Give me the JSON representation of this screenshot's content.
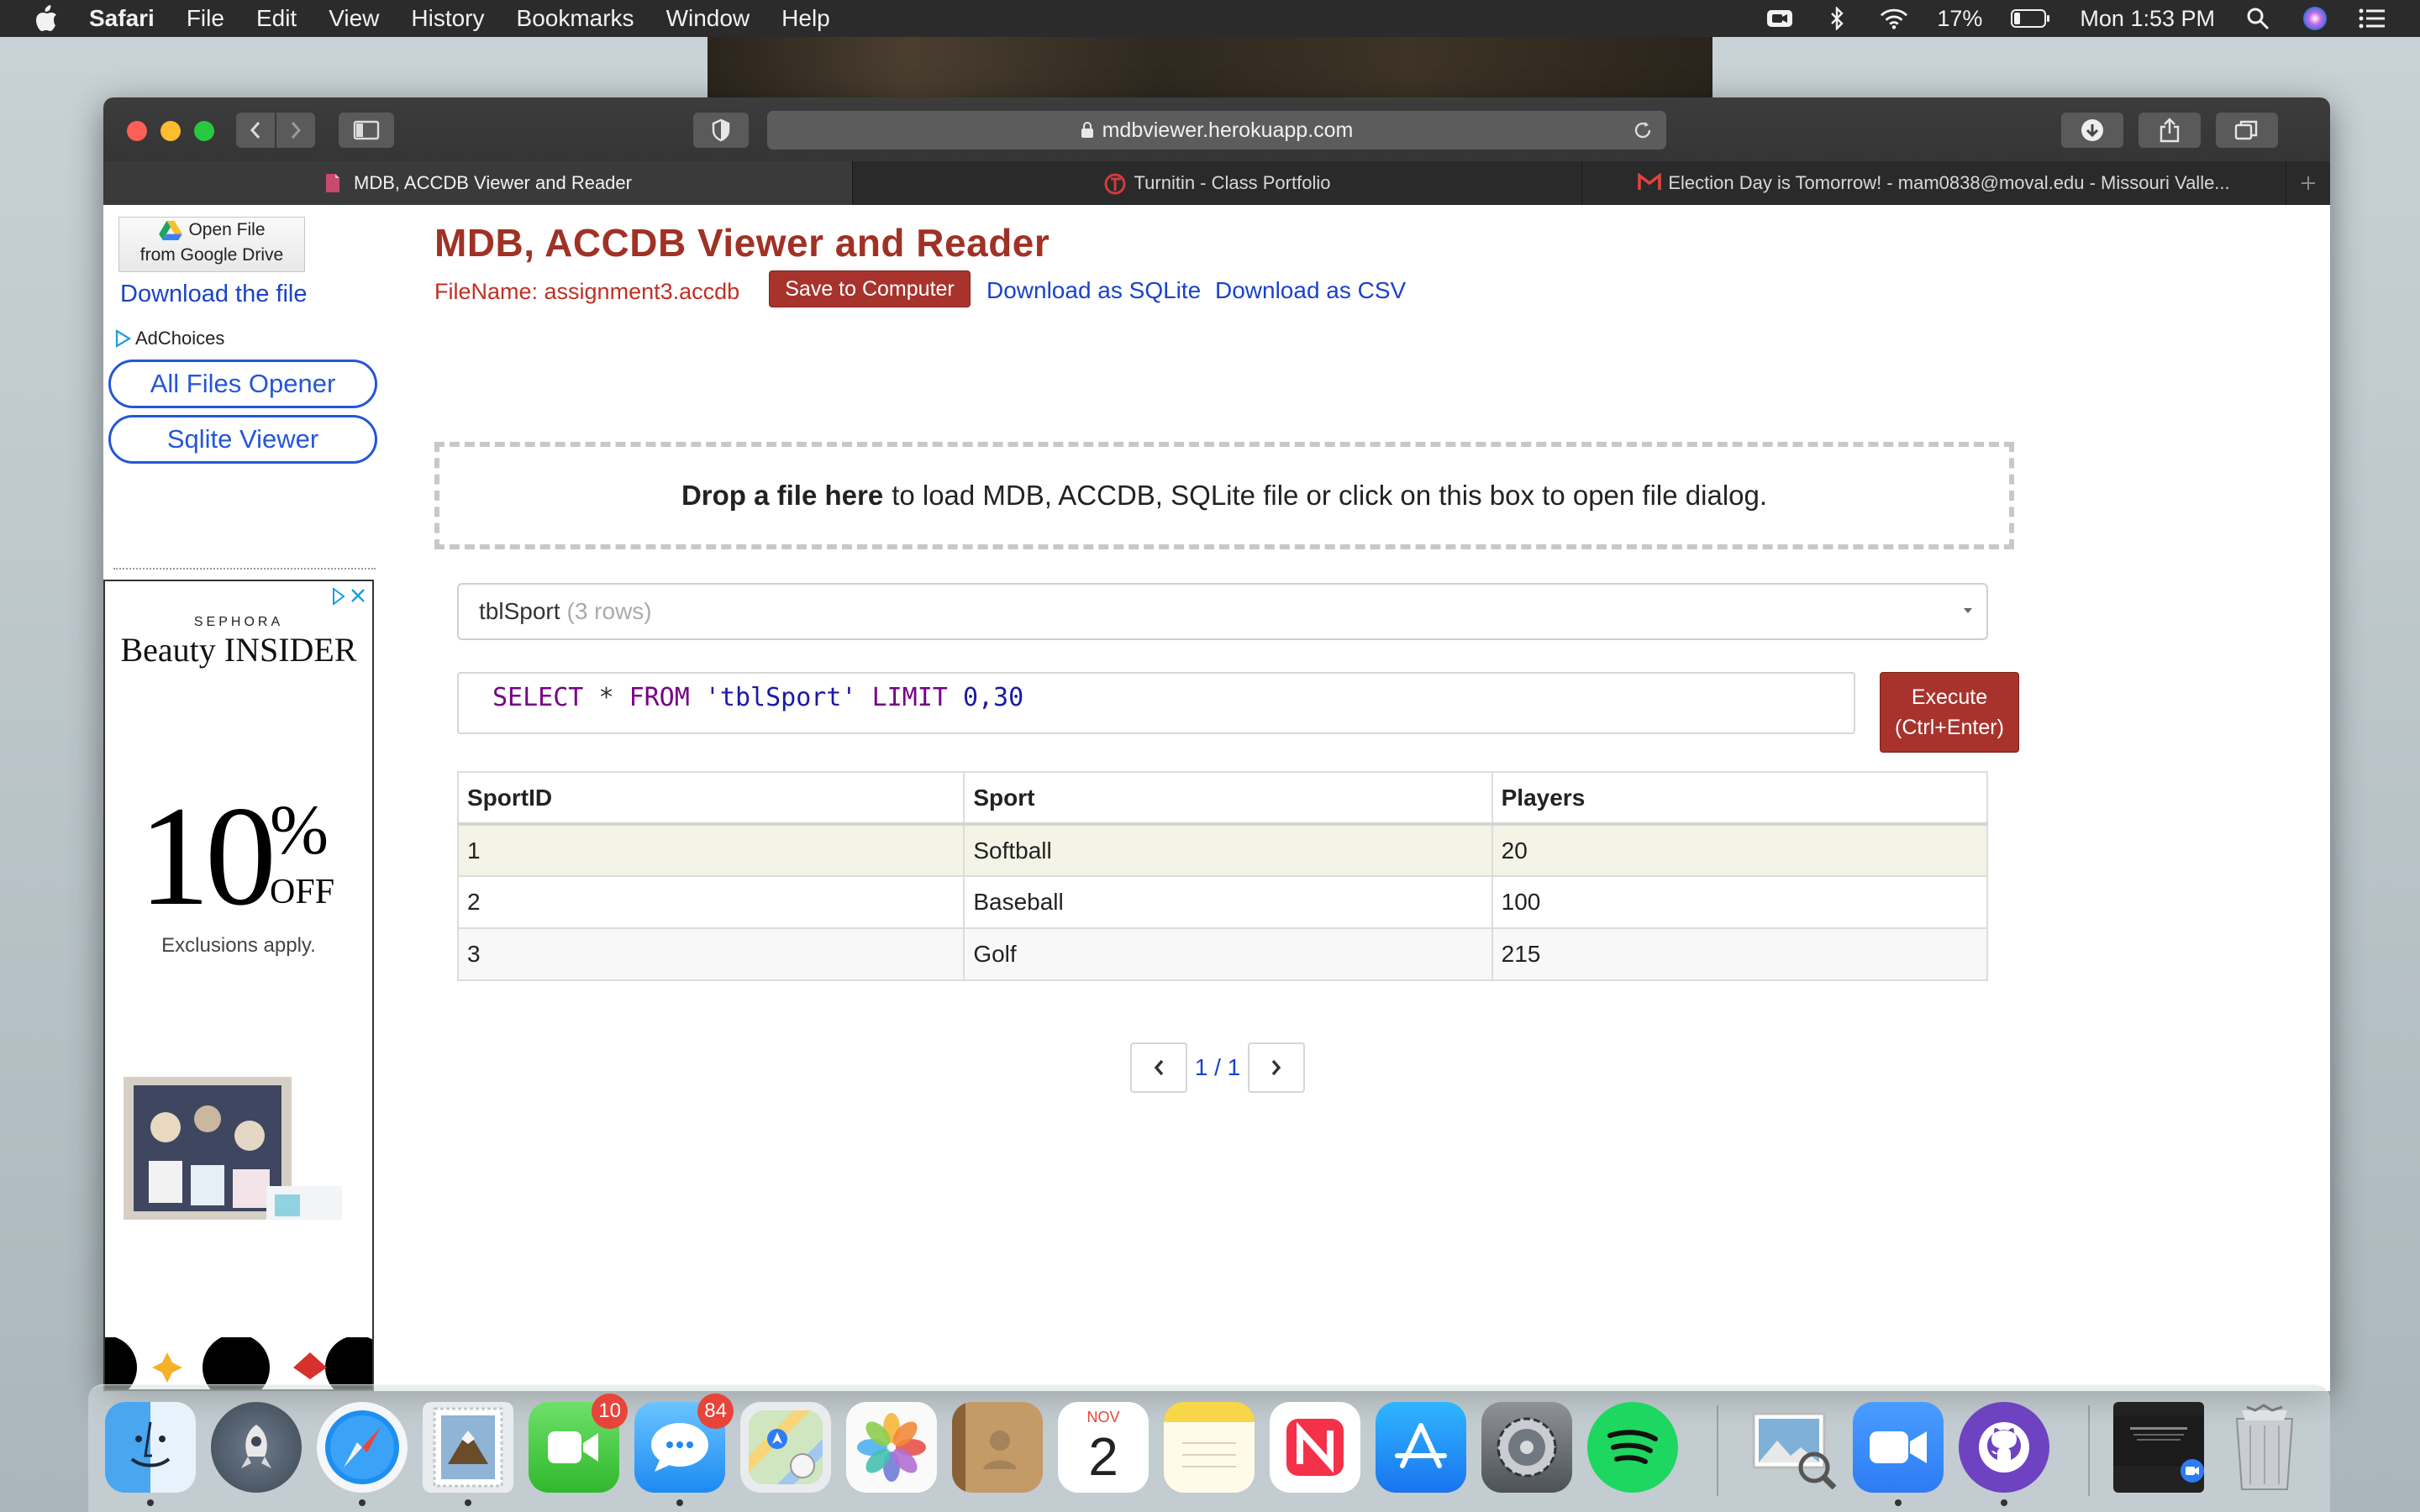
{
  "menubar": {
    "app": "Safari",
    "items": [
      "File",
      "Edit",
      "View",
      "History",
      "Bookmarks",
      "Window",
      "Help"
    ],
    "battery": "17%",
    "clock": "Mon 1:53 PM"
  },
  "browser": {
    "url": "mdbviewer.herokuapp.com",
    "tabs": [
      {
        "label": "MDB, ACCDB Viewer and Reader"
      },
      {
        "label": "Turnitin - Class Portfolio"
      },
      {
        "label": "Election Day is Tomorrow! - mam0838@moval.edu - Missouri Valle..."
      }
    ]
  },
  "sidebar": {
    "gdrive_line1": "Open File",
    "gdrive_line2": "from Google Drive",
    "download_link": "Download the file",
    "adchoices": "AdChoices",
    "all_files": "All Files Opener",
    "sqlite_viewer": "Sqlite Viewer",
    "ad": {
      "brand": "SEPHORA",
      "program": "Beauty INSIDER",
      "big": "10",
      "percent": "%",
      "off": "OFF",
      "note": "Exclusions apply."
    }
  },
  "main": {
    "title": "MDB, ACCDB Viewer and Reader",
    "filename": "FileName: assignment3.accdb",
    "save_button": "Save to Computer",
    "download_sqlite": "Download as SQLite",
    "download_csv": "Download as CSV",
    "drop_bold": "Drop a file here",
    "drop_rest": "to load MDB, ACCDB, SQLite file or click on this box to open file dialog.",
    "table_name": "tblSport",
    "table_rows": "(3 rows)",
    "sql": {
      "select": "SELECT",
      "star": "*",
      "from": "FROM",
      "table": "'tblSport'",
      "limit": "LIMIT",
      "range": "0,30"
    },
    "execute_line1": "Execute",
    "execute_line2": "(Ctrl+Enter)",
    "columns": [
      "SportID",
      "Sport",
      "Players"
    ],
    "rows": [
      [
        "1",
        "Softball",
        "20"
      ],
      [
        "2",
        "Baseball",
        "100"
      ],
      [
        "3",
        "Golf",
        "215"
      ]
    ],
    "page_indicator": "1 / 1"
  },
  "dock": {
    "facetime_badge": "10",
    "messages_badge": "84",
    "calendar_month": "NOV",
    "calendar_day": "2"
  }
}
